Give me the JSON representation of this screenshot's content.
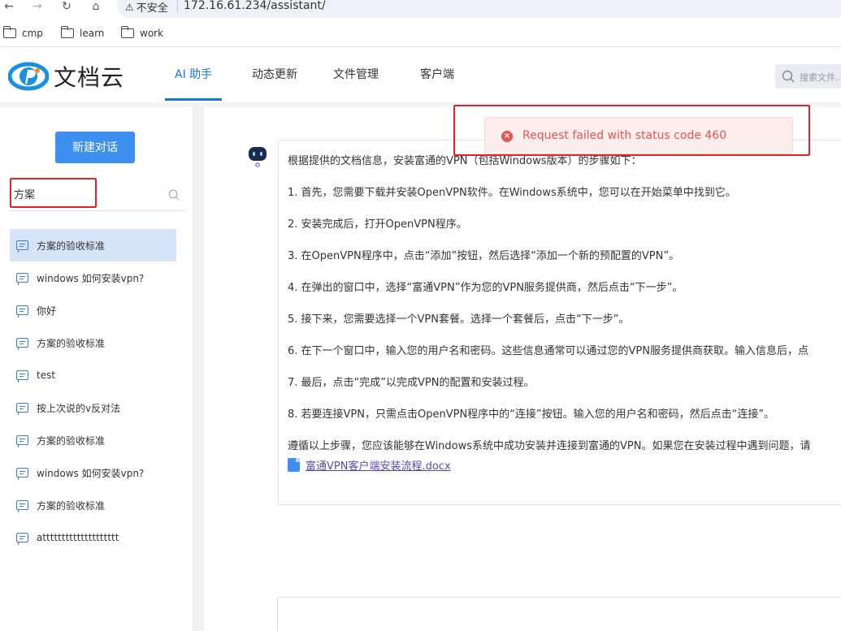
{
  "browser": {
    "security_label": "不安全",
    "url": "172.16.61.234/assistant/",
    "bookmarks": [
      "cmp",
      "learn",
      "work"
    ]
  },
  "header": {
    "logo_text": "文档云",
    "tabs": [
      "AI 助手",
      "动态更新",
      "文件管理",
      "客户端"
    ],
    "search_placeholder": "搜索文件..."
  },
  "sidebar": {
    "new_chat_label": "新建对话",
    "search_value": "方案",
    "conversations": [
      "方案的验收标准",
      "windows 如何安装vpn?",
      "你好",
      "方案的验收标准",
      "test",
      "按上次说的v反对法",
      "方案的验收标准",
      "windows 如何安装vpn?",
      "方案的验收标准",
      "atttttttttttttttttttt"
    ]
  },
  "toast": {
    "message": "Request failed with status code 460",
    "color": "#e55457"
  },
  "answer": {
    "intro": "根据提供的文档信息，安装富通的VPN（包括Windows版本）的步骤如下：",
    "steps": [
      "1. 首先，您需要下载并安装OpenVPN软件。在Windows系统中，您可以在开始菜单中找到它。",
      "2. 安装完成后，打开OpenVPN程序。",
      "3. 在OpenVPN程序中，点击“添加”按钮，然后选择“添加一个新的预配置的VPN”。",
      "4. 在弹出的窗口中，选择“富通VPN”作为您的VPN服务提供商，然后点击“下一步”。",
      "5. 接下来，您需要选择一个VPN套餐。选择一个套餐后，点击“下一步”。",
      "6. 在下一个窗口中，输入您的用户名和密码。这些信息通常可以通过您的VPN服务提供商获取。输入信息后，点",
      "7. 最后，点击“完成”以完成VPN的配置和安装过程。",
      "8. 若要连接VPN，只需点击OpenVPN程序中的“连接”按钮。输入您的用户名和密码，然后点击“连接”。"
    ],
    "conclusion": "遵循以上步骤，您应该能够在Windows系统中成功安装并连接到富通的VPN。如果您在安装过程中遇到问题，请",
    "attachment": "富通VPN客户端安装流程.docx"
  },
  "colors": {
    "accent": "#1677d2",
    "button": "#3d8ff0",
    "highlight": "#e0242a"
  }
}
